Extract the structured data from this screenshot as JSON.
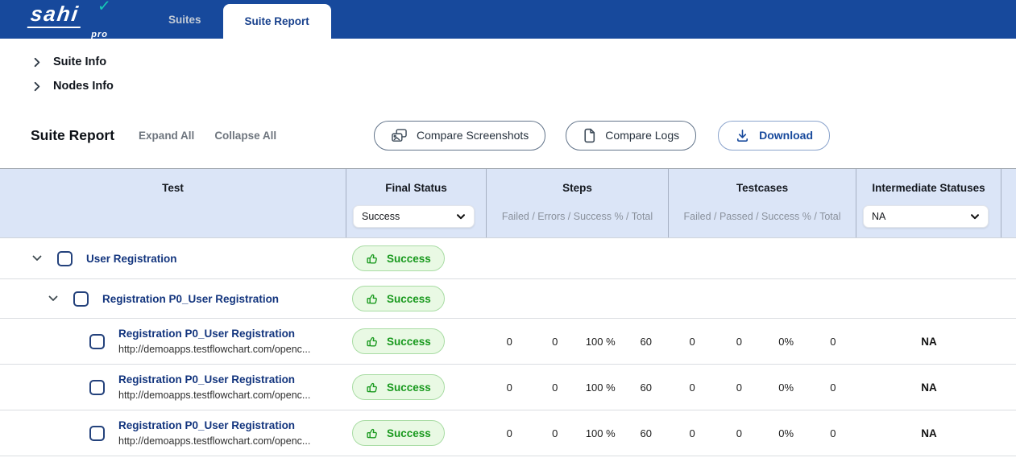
{
  "navbar": {
    "brand": {
      "text": "sahi",
      "sub": "pro",
      "check": "✓"
    },
    "tabs": [
      {
        "label": "Suites"
      },
      {
        "label": "Suite Report"
      }
    ]
  },
  "sections": {
    "suite_info": "Suite Info",
    "nodes_info": "Nodes Info"
  },
  "toolbar": {
    "title": "Suite Report",
    "expand_all": "Expand All",
    "collapse_all": "Collapse All",
    "compare_screenshots": "Compare Screenshots",
    "compare_logs": "Compare Logs",
    "download": "Download"
  },
  "table": {
    "header": {
      "test": "Test",
      "final_status": "Final Status",
      "steps": "Steps",
      "steps_sub": "Failed / Errors / Success % / Total",
      "testcases": "Testcases",
      "testcases_sub": "Failed / Passed / Success % / Total",
      "intermediate": "Intermediate Statuses"
    },
    "filters": {
      "final_status": "Success",
      "intermediate": "NA"
    },
    "rows": [
      {
        "type": "group",
        "level": 1,
        "title": "User Registration",
        "status": "Success"
      },
      {
        "type": "group",
        "level": 2,
        "title": "Registration P0_User Registration",
        "status": "Success"
      },
      {
        "type": "test",
        "title": "Registration P0_User Registration",
        "url": "http://demoapps.testflowchart.com/openc...",
        "status": "Success",
        "steps_failed": "0",
        "steps_errors": "0",
        "steps_success_pct": "100 %",
        "steps_total": "60",
        "tc_failed": "0",
        "tc_passed": "0",
        "tc_success_pct": "0%",
        "tc_total": "0",
        "intermediate": "NA"
      },
      {
        "type": "test",
        "title": "Registration P0_User Registration",
        "url": "http://demoapps.testflowchart.com/openc...",
        "status": "Success",
        "steps_failed": "0",
        "steps_errors": "0",
        "steps_success_pct": "100 %",
        "steps_total": "60",
        "tc_failed": "0",
        "tc_passed": "0",
        "tc_success_pct": "0%",
        "tc_total": "0",
        "intermediate": "NA"
      },
      {
        "type": "test",
        "title": "Registration P0_User Registration",
        "url": "http://demoapps.testflowchart.com/openc...",
        "status": "Success",
        "steps_failed": "0",
        "steps_errors": "0",
        "steps_success_pct": "100 %",
        "steps_total": "60",
        "tc_failed": "0",
        "tc_passed": "0",
        "tc_success_pct": "0%",
        "tc_total": "0",
        "intermediate": "NA"
      }
    ]
  },
  "colors": {
    "navbar_bg": "#17499c",
    "link_blue": "#13357e",
    "success_green": "#18991d",
    "badge_bg": "#e9f9e4",
    "badge_border": "#a9dca4",
    "header_bg": "#dbe5f7",
    "brand_check": "#16c9b5"
  }
}
